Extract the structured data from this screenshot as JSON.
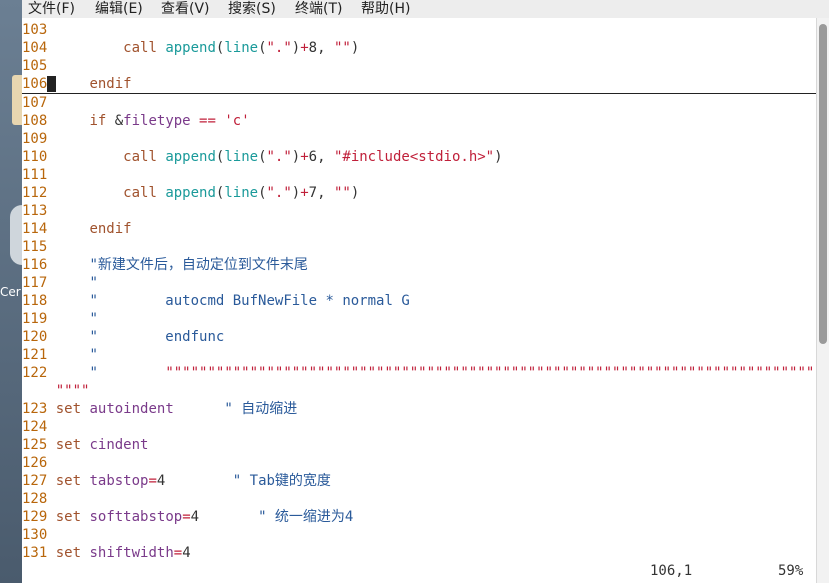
{
  "desktop": {
    "icon_label": "Cer"
  },
  "menubar": {
    "items": [
      "文件(F)",
      "编辑(E)",
      "查看(V)",
      "搜索(S)",
      "终端(T)",
      "帮助(H)"
    ]
  },
  "editor": {
    "lines": [
      {
        "n": "103",
        "t": [
          {
            "c": "pl",
            "s": ""
          }
        ]
      },
      {
        "n": "104",
        "t": [
          {
            "c": "pl",
            "s": "    "
          },
          {
            "c": "kw",
            "s": "call"
          },
          {
            "c": "pl",
            "s": " "
          },
          {
            "c": "fn",
            "s": "append"
          },
          {
            "c": "pl",
            "s": "("
          },
          {
            "c": "fn",
            "s": "line"
          },
          {
            "c": "pl",
            "s": "("
          },
          {
            "c": "str",
            "s": "\".\""
          },
          {
            "c": "pl",
            "s": ")"
          },
          {
            "c": "op",
            "s": "+"
          },
          {
            "c": "pl",
            "s": "8, "
          },
          {
            "c": "str",
            "s": "\"\""
          },
          {
            "c": "pl",
            "s": ")"
          }
        ]
      },
      {
        "n": "105",
        "t": [
          {
            "c": "pl",
            "s": ""
          }
        ]
      },
      {
        "n": "106",
        "t": [
          {
            "c": "kw",
            "s": "endif"
          }
        ],
        "cursor": true
      },
      {
        "n": "107",
        "t": [
          {
            "c": "pl",
            "s": ""
          }
        ]
      },
      {
        "n": "108",
        "t": [
          {
            "c": "kw",
            "s": "if"
          },
          {
            "c": "pl",
            "s": " &"
          },
          {
            "c": "vn",
            "s": "filetype"
          },
          {
            "c": "pl",
            "s": " "
          },
          {
            "c": "op",
            "s": "=="
          },
          {
            "c": "pl",
            "s": " "
          },
          {
            "c": "str",
            "s": "'c'"
          }
        ]
      },
      {
        "n": "109",
        "t": [
          {
            "c": "pl",
            "s": ""
          }
        ]
      },
      {
        "n": "110",
        "t": [
          {
            "c": "pl",
            "s": "    "
          },
          {
            "c": "kw",
            "s": "call"
          },
          {
            "c": "pl",
            "s": " "
          },
          {
            "c": "fn",
            "s": "append"
          },
          {
            "c": "pl",
            "s": "("
          },
          {
            "c": "fn",
            "s": "line"
          },
          {
            "c": "pl",
            "s": "("
          },
          {
            "c": "str",
            "s": "\".\""
          },
          {
            "c": "pl",
            "s": ")"
          },
          {
            "c": "op",
            "s": "+"
          },
          {
            "c": "pl",
            "s": "6, "
          },
          {
            "c": "str",
            "s": "\"#include<stdio.h>\""
          },
          {
            "c": "pl",
            "s": ")"
          }
        ]
      },
      {
        "n": "111",
        "t": [
          {
            "c": "pl",
            "s": ""
          }
        ]
      },
      {
        "n": "112",
        "t": [
          {
            "c": "pl",
            "s": "    "
          },
          {
            "c": "kw",
            "s": "call"
          },
          {
            "c": "pl",
            "s": " "
          },
          {
            "c": "fn",
            "s": "append"
          },
          {
            "c": "pl",
            "s": "("
          },
          {
            "c": "fn",
            "s": "line"
          },
          {
            "c": "pl",
            "s": "("
          },
          {
            "c": "str",
            "s": "\".\""
          },
          {
            "c": "pl",
            "s": ")"
          },
          {
            "c": "op",
            "s": "+"
          },
          {
            "c": "pl",
            "s": "7, "
          },
          {
            "c": "str",
            "s": "\"\""
          },
          {
            "c": "pl",
            "s": ")"
          }
        ]
      },
      {
        "n": "113",
        "t": [
          {
            "c": "pl",
            "s": ""
          }
        ]
      },
      {
        "n": "114",
        "t": [
          {
            "c": "kw",
            "s": "endif"
          }
        ]
      },
      {
        "n": "115",
        "t": [
          {
            "c": "pl",
            "s": ""
          }
        ]
      },
      {
        "n": "116",
        "t": [
          {
            "c": "cm",
            "s": "\"新建文件后，自动定位到文件末尾"
          }
        ]
      },
      {
        "n": "117",
        "t": [
          {
            "c": "cm",
            "s": "\""
          }
        ]
      },
      {
        "n": "118",
        "t": [
          {
            "c": "cm",
            "s": "\"        autocmd BufNewFile * normal G"
          }
        ]
      },
      {
        "n": "119",
        "t": [
          {
            "c": "cm",
            "s": "\""
          }
        ]
      },
      {
        "n": "120",
        "t": [
          {
            "c": "cm",
            "s": "\"        endfunc"
          }
        ]
      },
      {
        "n": "121",
        "t": [
          {
            "c": "cm",
            "s": "\""
          }
        ]
      },
      {
        "n": "122",
        "t": [
          {
            "c": "cm",
            "s": "\"        "
          },
          {
            "c": "str",
            "s": "\"\"\"\"\"\"\"\"\"\"\"\"\"\"\"\"\"\"\"\"\"\"\"\"\"\"\"\"\"\"\"\"\"\"\"\"\"\"\"\"\"\"\"\"\"\"\"\"\"\"\"\"\"\"\"\"\"\"\"\"\"\"\"\"\"\"\"\"\"\"\"\"\"\"\"\"\"\"\"\"\"\"\""
          }
        ],
        "wrap": "\"\"\"\""
      },
      {
        "n": "123",
        "t": [
          {
            "c": "kw",
            "s": "set"
          },
          {
            "c": "pl",
            "s": " "
          },
          {
            "c": "vn",
            "s": "autoindent"
          },
          {
            "c": "pl",
            "s": "      "
          },
          {
            "c": "cm",
            "s": "\" 自动缩进"
          }
        ],
        "top": true
      },
      {
        "n": "124",
        "t": [
          {
            "c": "pl",
            "s": ""
          }
        ],
        "top": true
      },
      {
        "n": "125",
        "t": [
          {
            "c": "kw",
            "s": "set"
          },
          {
            "c": "pl",
            "s": " "
          },
          {
            "c": "vn",
            "s": "cindent"
          }
        ],
        "top": true
      },
      {
        "n": "126",
        "t": [
          {
            "c": "pl",
            "s": ""
          }
        ],
        "top": true
      },
      {
        "n": "127",
        "t": [
          {
            "c": "kw",
            "s": "set"
          },
          {
            "c": "pl",
            "s": " "
          },
          {
            "c": "vn",
            "s": "tabstop"
          },
          {
            "c": "op",
            "s": "="
          },
          {
            "c": "pl",
            "s": "4        "
          },
          {
            "c": "cm",
            "s": "\" Tab键的宽度"
          }
        ],
        "top": true
      },
      {
        "n": "128",
        "t": [
          {
            "c": "pl",
            "s": ""
          }
        ],
        "top": true
      },
      {
        "n": "129",
        "t": [
          {
            "c": "kw",
            "s": "set"
          },
          {
            "c": "pl",
            "s": " "
          },
          {
            "c": "vn",
            "s": "softtabstop"
          },
          {
            "c": "op",
            "s": "="
          },
          {
            "c": "pl",
            "s": "4       "
          },
          {
            "c": "cm",
            "s": "\" 统一缩进为4"
          }
        ],
        "top": true
      },
      {
        "n": "130",
        "t": [
          {
            "c": "pl",
            "s": ""
          }
        ],
        "top": true
      },
      {
        "n": "131",
        "t": [
          {
            "c": "kw",
            "s": "set"
          },
          {
            "c": "pl",
            "s": " "
          },
          {
            "c": "vn",
            "s": "shiftwidth"
          },
          {
            "c": "op",
            "s": "="
          },
          {
            "c": "pl",
            "s": "4"
          }
        ],
        "top": true
      }
    ]
  },
  "status": {
    "position": "106,1",
    "percent": "59%"
  }
}
